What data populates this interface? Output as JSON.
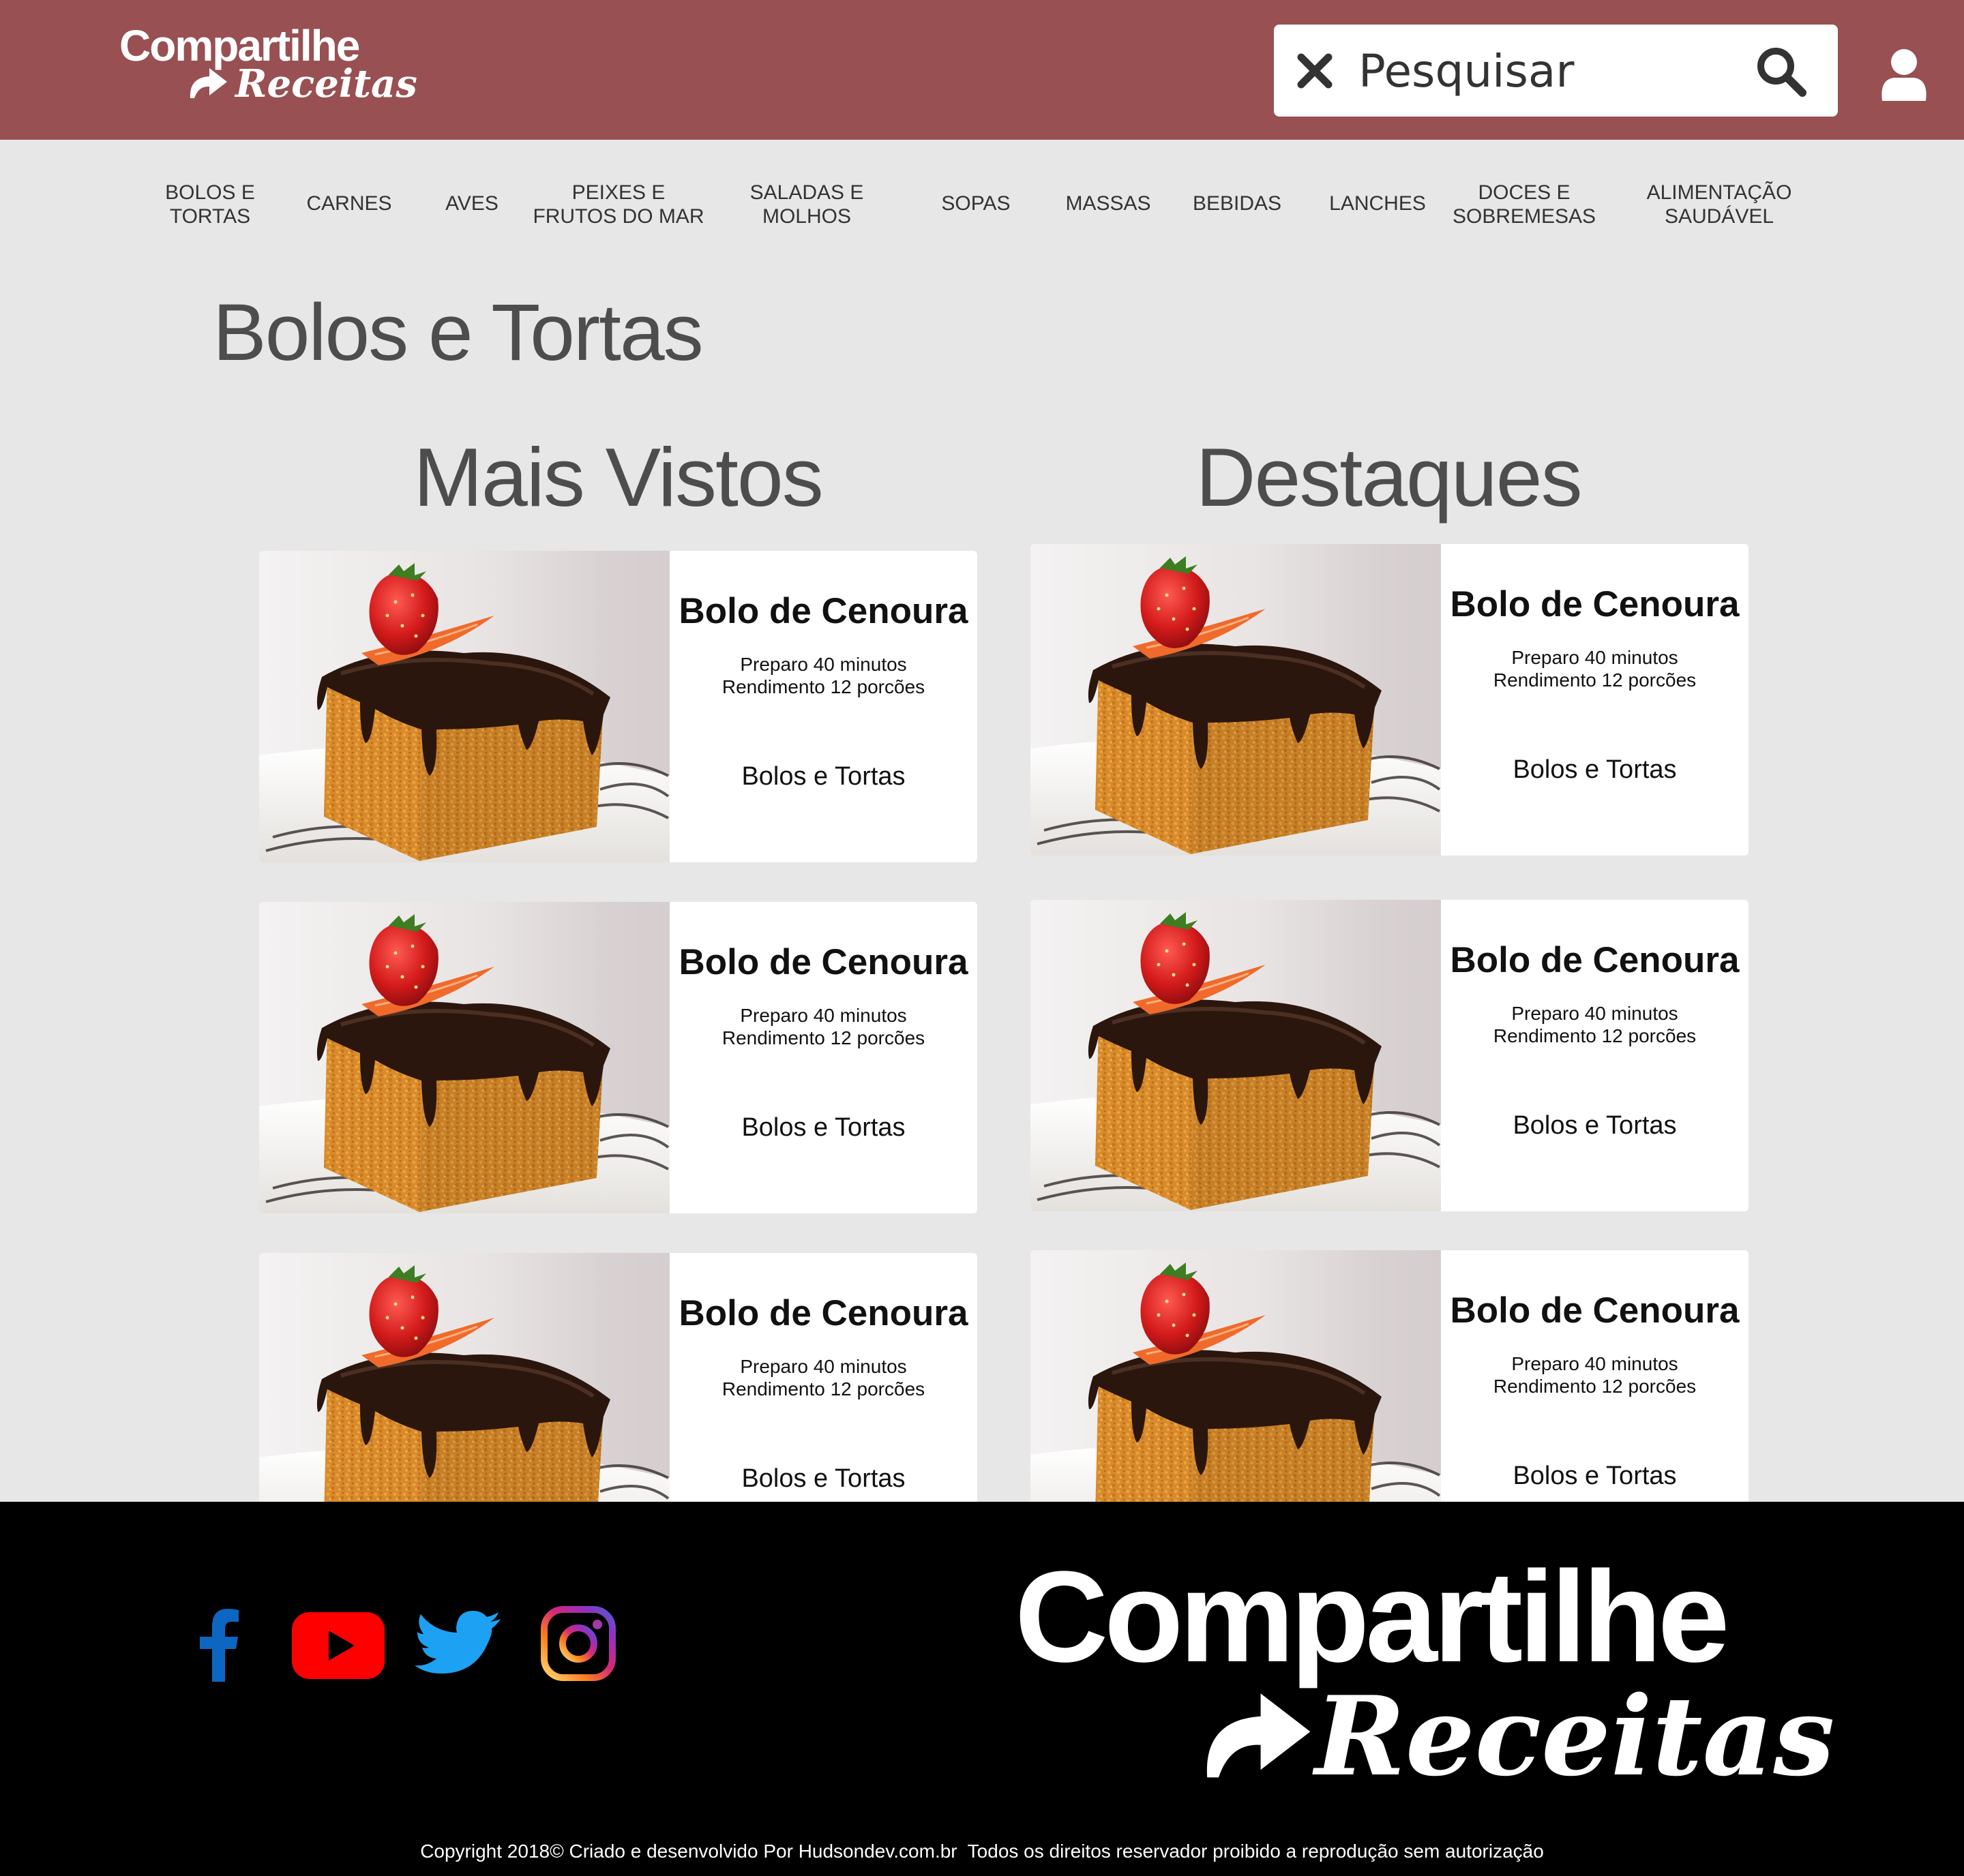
{
  "header": {
    "logo_line1": "Compartilhe",
    "logo_line2": "Receitas",
    "search_placeholder": "Pesquisar"
  },
  "nav": {
    "items": [
      {
        "label": "BOLOS E\nTORTAS"
      },
      {
        "label": "CARNES"
      },
      {
        "label": "AVES"
      },
      {
        "label": "PEIXES E\nFRUTOS DO MAR"
      },
      {
        "label": "SALADAS  E\nMOLHOS"
      },
      {
        "label": "SOPAS"
      },
      {
        "label": "MASSAS"
      },
      {
        "label": "BEBIDAS"
      },
      {
        "label": "LANCHES"
      },
      {
        "label": "DOCES E\nSOBREMESAS"
      },
      {
        "label": "ALIMENTAÇÃO\nSAUDÁVEL"
      }
    ]
  },
  "page": {
    "title": "Bolos e Tortas"
  },
  "sections": [
    {
      "title": "Mais Vistos",
      "cards": [
        {
          "title": "Bolo de Cenoura",
          "prep": "Preparo 40 minutos",
          "yield": "Rendimento 12 porcões",
          "category": "Bolos e Tortas"
        },
        {
          "title": "Bolo de Cenoura",
          "prep": "Preparo 40 minutos",
          "yield": "Rendimento 12 porcões",
          "category": "Bolos e Tortas"
        },
        {
          "title": "Bolo de Cenoura",
          "prep": "Preparo 40 minutos",
          "yield": "Rendimento 12 porcões",
          "category": "Bolos e Tortas"
        }
      ]
    },
    {
      "title": "Destaques",
      "cards": [
        {
          "title": "Bolo de Cenoura",
          "prep": "Preparo 40 minutos",
          "yield": "Rendimento 12 porcões",
          "category": "Bolos e Tortas"
        },
        {
          "title": "Bolo de Cenoura",
          "prep": "Preparo 40 minutos",
          "yield": "Rendimento 12 porcões",
          "category": "Bolos e Tortas"
        },
        {
          "title": "Bolo de Cenoura",
          "prep": "Preparo 40 minutos",
          "yield": "Rendimento 12 porcões",
          "category": "Bolos e Tortas"
        }
      ]
    }
  ],
  "footer": {
    "logo_line1": "Compartilhe",
    "logo_line2": "Receitas",
    "social": [
      "facebook-icon",
      "youtube-icon",
      "twitter-icon",
      "instagram-icon"
    ],
    "copyright": "Copyright 2018© Criado e desenvolvido Por Hudsondev.com.br  Todos os direitos reservador proibido a reprodução sem autorização"
  },
  "colors": {
    "header_bg": "#985052",
    "page_bg": "#e7e7e7",
    "footer_bg": "#000000",
    "facebook": "#0d66c2",
    "youtube": "#ff0000",
    "twitter": "#1da1f2"
  }
}
